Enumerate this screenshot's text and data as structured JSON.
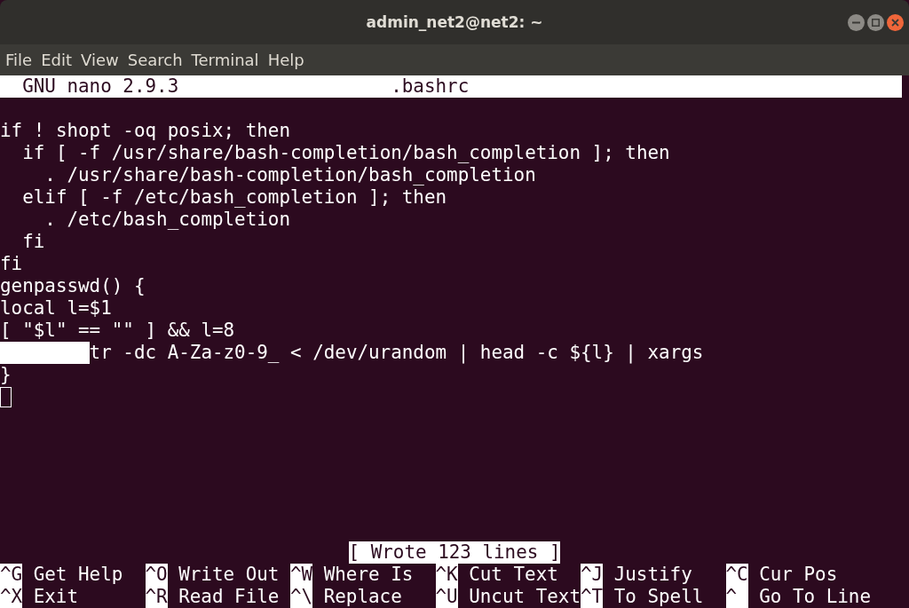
{
  "window": {
    "title": "admin_net2@net2: ~"
  },
  "menu": [
    "File",
    "Edit",
    "View",
    "Search",
    "Terminal",
    "Help"
  ],
  "nano_header": {
    "version": "GNU nano 2.9.3",
    "filename": ".bashrc"
  },
  "lines": [
    {
      "kind": "code",
      "text": "if ! shopt -oq posix; then"
    },
    {
      "kind": "code",
      "text": "  if [ -f /usr/share/bash-completion/bash_completion ]; then"
    },
    {
      "kind": "code",
      "text": "    . /usr/share/bash-completion/bash_completion"
    },
    {
      "kind": "code",
      "text": "  elif [ -f /etc/bash_completion ]; then"
    },
    {
      "kind": "code",
      "text": "    . /etc/bash_completion"
    },
    {
      "kind": "code",
      "text": "  fi"
    },
    {
      "kind": "code",
      "text": "fi"
    },
    {
      "kind": "code",
      "text": "genpasswd() {"
    },
    {
      "kind": "code",
      "text": "local l=$1"
    },
    {
      "kind": "code",
      "text": "[ \"$l\" == \"\" ] && l=8"
    },
    {
      "kind": "marked",
      "text": "tr -dc A-Za-z0-9_ < /dev/urandom | head -c ${l} | xargs"
    },
    {
      "kind": "code",
      "text": "}"
    },
    {
      "kind": "cursor"
    }
  ],
  "status": "[ Wrote 123 lines ]",
  "shortcuts": [
    [
      {
        "key": "^G",
        "label": "Get Help"
      },
      {
        "key": "^O",
        "label": "Write Out"
      },
      {
        "key": "^W",
        "label": "Where Is"
      },
      {
        "key": "^K",
        "label": "Cut Text"
      },
      {
        "key": "^J",
        "label": "Justify"
      },
      {
        "key": "^C",
        "label": "Cur Pos"
      }
    ],
    [
      {
        "key": "^X",
        "label": "Exit"
      },
      {
        "key": "^R",
        "label": "Read File"
      },
      {
        "key": "^\\",
        "label": "Replace"
      },
      {
        "key": "^U",
        "label": "Uncut Text"
      },
      {
        "key": "^T",
        "label": "To Spell"
      },
      {
        "key": "^",
        "label": "Go To Line"
      }
    ]
  ]
}
